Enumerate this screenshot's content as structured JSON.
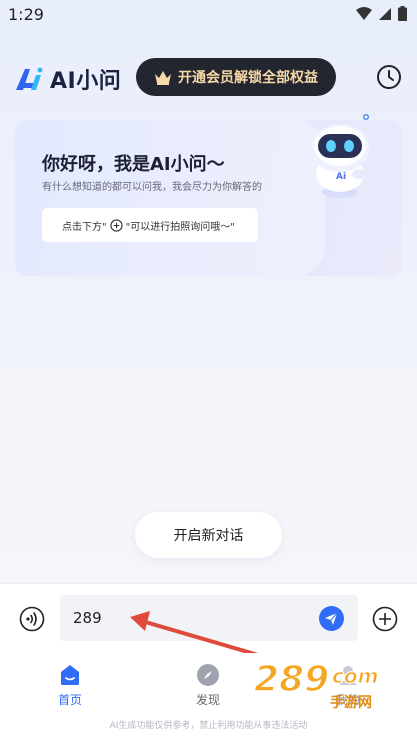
{
  "status_bar": {
    "time": "1:29"
  },
  "header": {
    "app_name": "AI小问",
    "vip_label": "开通会员解锁全部权益",
    "history_icon": "clock-icon"
  },
  "welcome": {
    "title": "你好呀，我是AI小问～",
    "subtitle": "有什么想知道的都可以问我，我会尽力为你解答的",
    "hint_prefix": "点击下方\"",
    "hint_suffix": "\"可以进行拍照询问哦～\""
  },
  "new_chat_label": "开启新对话",
  "input": {
    "value": "289"
  },
  "nav": {
    "items": [
      {
        "label": "首页",
        "icon": "home-icon",
        "active": true
      },
      {
        "label": "发现",
        "icon": "compass-icon",
        "active": false
      },
      {
        "label": "我的",
        "icon": "user-icon",
        "active": false
      }
    ]
  },
  "disclaimer": "AI生成功能仅供参考，禁止利用功能从事违法活动",
  "watermark": {
    "main": "289",
    "suffix": "com",
    "sub": "手游网"
  },
  "colors": {
    "accent": "#2f6df6",
    "vip_bg": "#23262e",
    "vip_text": "#f6d9a8",
    "annotation": "#e04a3a"
  }
}
